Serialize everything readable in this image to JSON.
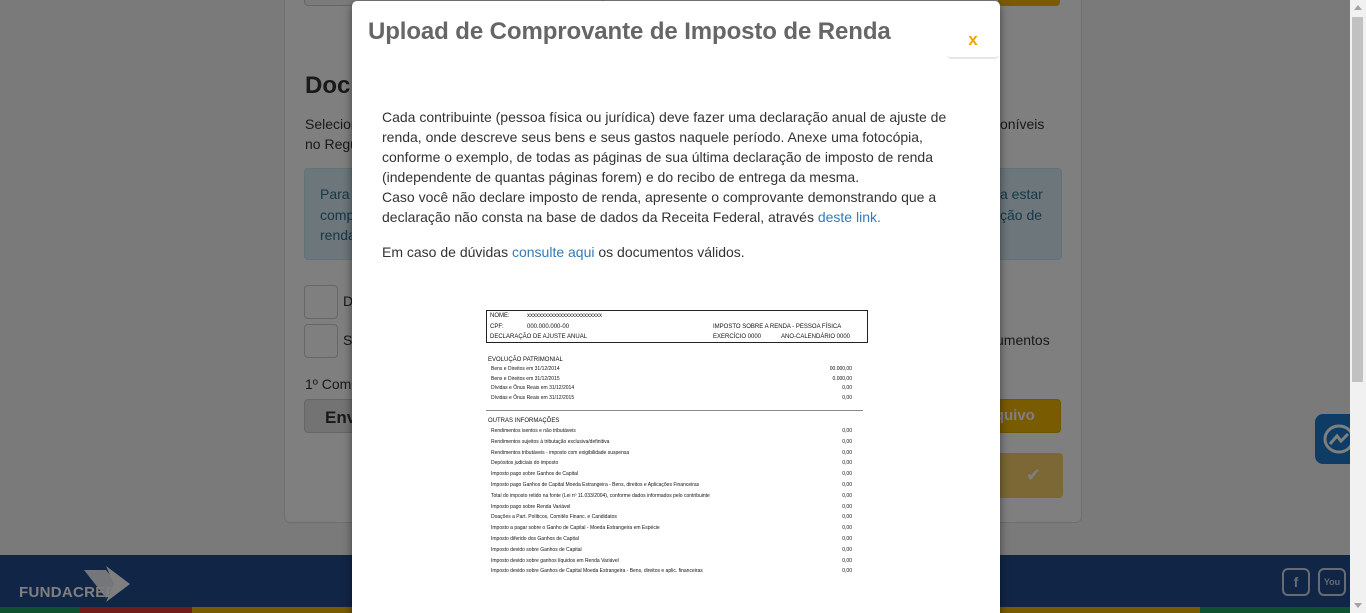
{
  "background": {
    "heading": "Doc",
    "intro_line1_left": "Selecion",
    "intro_line1_right": "oníveis",
    "intro_line2_left": "no Regu",
    "alert_lines_left": [
      "Para",
      "comp",
      "renda"
    ],
    "alert_lines_right": [
      "a estar",
      "ção de"
    ],
    "checkbox_labels": [
      "D",
      "S"
    ],
    "checkbox2_right": "umentos",
    "label_first": "1º Com",
    "send_button": "Env",
    "file_button": "rquivo",
    "confirm_icon": "check-icon",
    "footer_logo": "FUNDACRED",
    "social": [
      "facebook-icon",
      "youtube-icon"
    ]
  },
  "modal": {
    "title": "Upload de Comprovante de Imposto de Renda",
    "close_label": "x",
    "paragraph1": "Cada contribuinte (pessoa física ou jurídica) deve fazer uma declaração anual de ajuste de renda, onde descreve seus bens e seus gastos naquele período. Anexe uma fotocópia, conforme o exemplo, de todas as páginas de sua última declaração de imposto de renda (independente de quantas páginas forem) e do recibo de entrega da mesma.",
    "paragraph2_text": "Caso você não declare imposto de renda, apresente o comprovante demonstrando que a declaração não consta na base de dados da Receita Federal, através ",
    "paragraph2_link": "deste link.",
    "paragraph3_prefix": "Em caso de dúvidas ",
    "paragraph3_link": "consulte aqui",
    "paragraph3_suffix": " os documentos válidos."
  },
  "document": {
    "nome_label": "NOME:",
    "nome_value": "xxxxxxxxxxxxxxxxxxxxxxxxx",
    "cpf_label": "CPF:",
    "cpf_value": "000.000.000-00",
    "imposto_title": "IMPOSTO SOBRE A RENDA - PESSOA FÍSICA",
    "declaracao": "DECLARAÇÃO DE AJUSTE ANUAL",
    "exercicio": "EXERCÍCIO 0000",
    "ano": "ANO-CALENDÁRIO 0000",
    "section1_title": "EVOLUÇÃO PATRIMONIAL",
    "section1_rows": [
      {
        "label": "Bens e Direitos em 31/12/2014",
        "value": "00.000,00"
      },
      {
        "label": "Bens e Direitos em 31/12/2015",
        "value": "0.000,00"
      },
      {
        "label": "Dívidas e Ônus Reais em 31/12/2014",
        "value": "0,00"
      },
      {
        "label": "Dívidas e Ônus Reais em 31/12/2015",
        "value": "0,00"
      }
    ],
    "section2_title": "OUTRAS INFORMAÇÕES",
    "section2_rows": [
      {
        "label": "Rendimentos isentos e não tributáveis",
        "value": "0,00"
      },
      {
        "label": "Rendimentos sujeitos à tributação exclusiva/definitiva",
        "value": "0,00"
      },
      {
        "label": "Rendimentos tributáveis - imposto com exigibilidade suspensa",
        "value": "0,00"
      },
      {
        "label": "Depósitos judiciais do imposto",
        "value": "0,00"
      },
      {
        "label": "Imposto pago sobre Ganhos de Capital",
        "value": "0,00"
      },
      {
        "label": "Imposto pago Ganhos de Capital Moeda Estrangeira - Bens, direitos e Aplicações Financeiras",
        "value": "0,00"
      },
      {
        "label": "Total do imposto retido na fonte  (Lei nº 11.033/2004), conforme dados informados pelo contribuinte",
        "value": "0,00"
      },
      {
        "label": "Imposto pago sobre Renda Variável",
        "value": "0,00"
      },
      {
        "label": "Doações a Part. Políticos, Comitês Financ. e Candidatos",
        "value": "0,00"
      },
      {
        "label": "Imposto a pagar sobre o Ganho de Capital - Moeda Estrangeira em Espécie",
        "value": "0,00"
      },
      {
        "label": "Imposto diferido dos Ganhos de Capital",
        "value": "0,00"
      },
      {
        "label": "Imposto devido sobre Ganhos de Capital",
        "value": "0,00"
      },
      {
        "label": "Imposto devido sobre ganhos líquidos em Renda Variável",
        "value": "0,00"
      },
      {
        "label": "Imposto devido sobre Ganhos de Capital Moeda Estrangeira - Bens, direitos e aplic. financeiras",
        "value": "0,00"
      }
    ]
  }
}
